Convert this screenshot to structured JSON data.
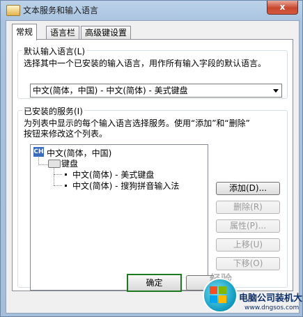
{
  "window": {
    "title": "文本服务和输入语言",
    "close_glyph": "x"
  },
  "tabs": [
    {
      "label": "常规",
      "active": true
    },
    {
      "label": "语言栏",
      "active": false
    },
    {
      "label": "高级键设置",
      "active": false
    }
  ],
  "default_language": {
    "group_label": "默认输入语言(L)",
    "description": "选择其中一个已安装的输入语言，用作所有输入字段的默认语言。",
    "selected": "中文(简体，中国) - 中文(简体) - 美式键盘"
  },
  "installed_services": {
    "group_label": "已安装的服务(I)",
    "description_line1": "为列表中显示的每个输入语言选择服务。使用“添加”和“删除”",
    "description_line2": "按钮来修改这个列表。",
    "tree": {
      "language_badge": "CH",
      "language": "中文(简体，中国)",
      "category": "键盘",
      "items": [
        "中文(简体) - 美式键盘",
        "中文(简体) - 搜狗拼音输入法"
      ]
    },
    "buttons": {
      "add": "添加(D)...",
      "remove": "删除(R)",
      "properties": "属性(P)...",
      "move_up": "上移(U)",
      "move_down": "下移(O)"
    }
  },
  "dialog_buttons": {
    "ok": "确定"
  },
  "watermark": {
    "faint_text": "经验",
    "title": "电脑公司装机大师",
    "url": "www.dngsos.com"
  },
  "colors": {
    "ok_border": "#1e7a1e",
    "selection_badge": "#3a6cc0"
  }
}
